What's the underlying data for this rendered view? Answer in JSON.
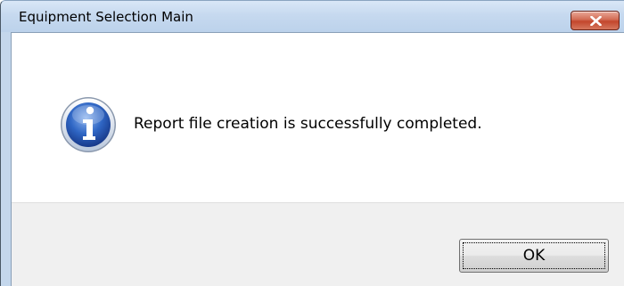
{
  "window": {
    "title": "Equipment Selection Main"
  },
  "titlebar": {
    "close_icon": "close-icon"
  },
  "dialog": {
    "icon": "info-icon",
    "message": "Report file creation is successfully completed.",
    "ok_label": "OK"
  },
  "colors": {
    "titlebar": "#c6d9ef",
    "close_button": "#c3462c",
    "footer": "#f0f0f0",
    "info_icon": "#2f66c4"
  }
}
